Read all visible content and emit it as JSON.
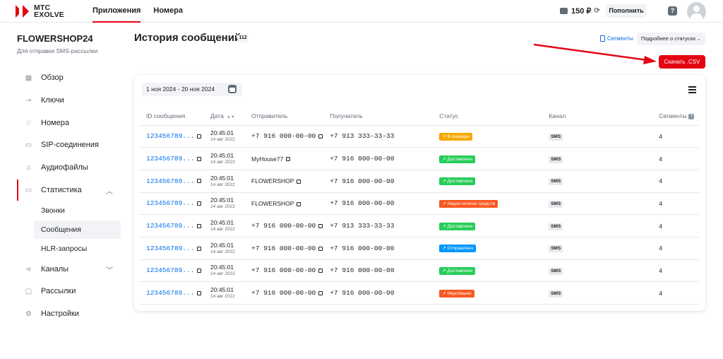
{
  "brand": {
    "line1": "МТС",
    "line2": "EXOLVE",
    "accent": "#e30611"
  },
  "nav": {
    "items": [
      "Приложения",
      "Номера"
    ]
  },
  "header": {
    "balance": "150 ₽",
    "topup_label": "Пополнить",
    "help_label": "?"
  },
  "sidebar": {
    "project_name": "FLOWERSHOP24",
    "project_desc": "Для отправки SMS-рассылки",
    "items": [
      {
        "label": "Обзор",
        "icon": "grid-icon"
      },
      {
        "label": "Ключи",
        "icon": "key-icon"
      },
      {
        "label": "Номера",
        "icon": "dialpad-icon"
      },
      {
        "label": "SIP-соединения",
        "icon": "sip-icon"
      },
      {
        "label": "Аудиофайлы",
        "icon": "music-icon"
      },
      {
        "label": "Статистика",
        "icon": "chart-icon"
      },
      {
        "label": "Каналы",
        "icon": "share-icon"
      },
      {
        "label": "Рассылки",
        "icon": "chat-icon"
      },
      {
        "label": "Настройки",
        "icon": "gear-icon"
      }
    ],
    "stats_sub": [
      "Звонки",
      "Сообщения",
      "HLR-запросы"
    ]
  },
  "main": {
    "title": "История сообщений",
    "count": "112",
    "segments_link": "Сегменты",
    "status_select": "Подробнее о статусах",
    "csv_button": "Скачать .CSV",
    "date_range": "1 ноя 2024 - 20 ноя 2024"
  },
  "table": {
    "headers": [
      "ID сообщения",
      "Дата",
      "Отправитель",
      "Получатель",
      "Статус",
      "Канал",
      "Сегменты"
    ],
    "rows": [
      {
        "id": "123456789...",
        "time": "20:45:01",
        "date": "14 авг 2022",
        "sender": "+7 916 000-00-00",
        "sender_mono": true,
        "recipient": "+7 913 333-33-33",
        "status": "В очереди",
        "status_color": "#f6a800",
        "channel": "SMS",
        "segments": "4"
      },
      {
        "id": "123456789...",
        "time": "20:45:01",
        "date": "14 авг 2022",
        "sender": "MyHouse77",
        "sender_mono": false,
        "recipient": "+7 916 000-00-00",
        "status": "Доставлено",
        "status_color": "#26cd58",
        "channel": "SMS",
        "segments": "4"
      },
      {
        "id": "123456789...",
        "time": "20:45:01",
        "date": "14 авг 2022",
        "sender": "FLOWERSHOP",
        "sender_mono": false,
        "recipient": "+7 916 000-00-00",
        "status": "Доставлено",
        "status_color": "#26cd58",
        "channel": "SMS",
        "segments": "4"
      },
      {
        "id": "123456789...",
        "time": "20:45:01",
        "date": "14 авг 2022",
        "sender": "FLOWERSHOP",
        "sender_mono": false,
        "recipient": "+7 916 000-00-00",
        "status": "Недостаточно средств",
        "status_color": "#f95721",
        "channel": "SMS",
        "segments": "4"
      },
      {
        "id": "123456789...",
        "time": "20:45:01",
        "date": "14 авг 2022",
        "sender": "+7 916 000-00-00",
        "sender_mono": true,
        "recipient": "+7 913 333-33-33",
        "status": "Доставлено",
        "status_color": "#26cd58",
        "channel": "SMS",
        "segments": "4"
      },
      {
        "id": "123456789...",
        "time": "20:45:01",
        "date": "14 авг 2022",
        "sender": "+7 916 000-00-00",
        "sender_mono": true,
        "recipient": "+7 916 000-00-00",
        "status": "Отправлено",
        "status_color": "#0097fd",
        "channel": "SMS",
        "segments": "4"
      },
      {
        "id": "123456789...",
        "time": "20:45:01",
        "date": "14 авг 2022",
        "sender": "+7 916 000-00-00",
        "sender_mono": true,
        "recipient": "+7 916 000-00-00",
        "status": "Доставлено",
        "status_color": "#26cd58",
        "channel": "SMS",
        "segments": "4"
      },
      {
        "id": "123456789...",
        "time": "20:45:01",
        "date": "14 авг 2022",
        "sender": "+7 916 000-00-00",
        "sender_mono": true,
        "recipient": "+7 916 000-00-00",
        "status": "Неуспешно",
        "status_color": "#f95721",
        "channel": "SMS",
        "segments": "4"
      }
    ]
  }
}
